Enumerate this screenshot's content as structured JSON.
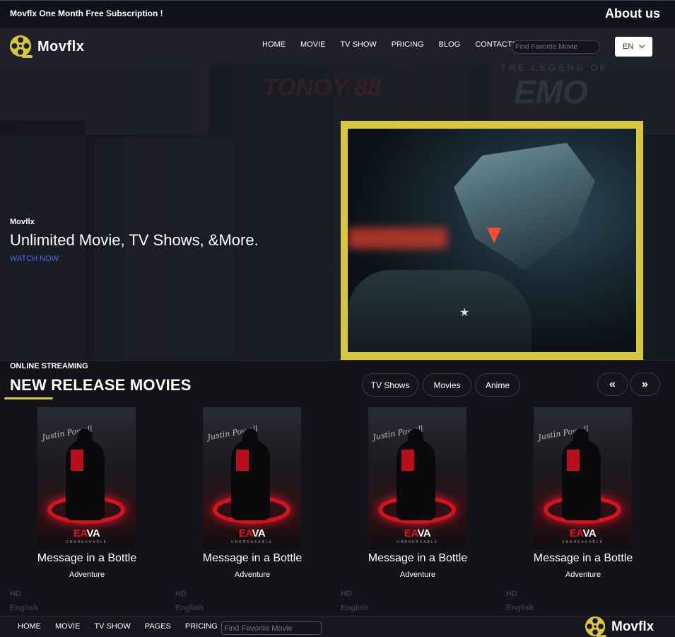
{
  "topbar": {
    "promo": "Movflx One Month Free Subscription !",
    "about": "About us"
  },
  "brand": {
    "name": "Movflx",
    "accent": "#d8c73a"
  },
  "nav": {
    "items": [
      "HOME",
      "MOVIE",
      "TV SHOW",
      "PRICING",
      "BLOG",
      "CONTACTS"
    ],
    "search_placeholder": "Find Favorite Movie",
    "language": "EN"
  },
  "hero": {
    "kicker": "Movflx",
    "headline": "Unlimited Movie, TV Shows, &More.",
    "cta": "WATCH NOW",
    "bg_texts": [
      "TONOY 88",
      "THE LEGEND OF",
      "EMO"
    ]
  },
  "release": {
    "eyebrow": "ONLINE STREAMING",
    "title": "NEW RELEASE MOVIES",
    "filters": [
      "TV Shows",
      "Movies",
      "Anime"
    ],
    "prev": "«",
    "next": "»",
    "cards": [
      {
        "title": "Message in a Bottle",
        "genre": "Adventure",
        "quality": "HD",
        "language": "English",
        "poster_brand_a": "EA",
        "poster_brand_b": "VA",
        "poster_sub": "UNBREAKABLE",
        "poster_script": "Justin Powell"
      },
      {
        "title": "Message in a Bottle",
        "genre": "Adventure",
        "quality": "HD",
        "language": "English",
        "poster_brand_a": "EA",
        "poster_brand_b": "VA",
        "poster_sub": "UNBREAKABLE",
        "poster_script": "Justin Powell"
      },
      {
        "title": "Message in a Bottle",
        "genre": "Adventure",
        "quality": "HD",
        "language": "English",
        "poster_brand_a": "EA",
        "poster_brand_b": "VA",
        "poster_sub": "UNBREAKABLE",
        "poster_script": "Justin Powell"
      },
      {
        "title": "Message in a Bottle",
        "genre": "Adventure",
        "quality": "HD",
        "language": "English",
        "poster_brand_a": "EA",
        "poster_brand_b": "VA",
        "poster_sub": "UNBREAKABLE",
        "poster_script": "Justin Powell"
      }
    ]
  },
  "footer": {
    "items": [
      "HOME",
      "MOVIE",
      "TV SHOW",
      "PAGES",
      "PRICING"
    ],
    "search_placeholder": "Find Favorite Movie"
  }
}
